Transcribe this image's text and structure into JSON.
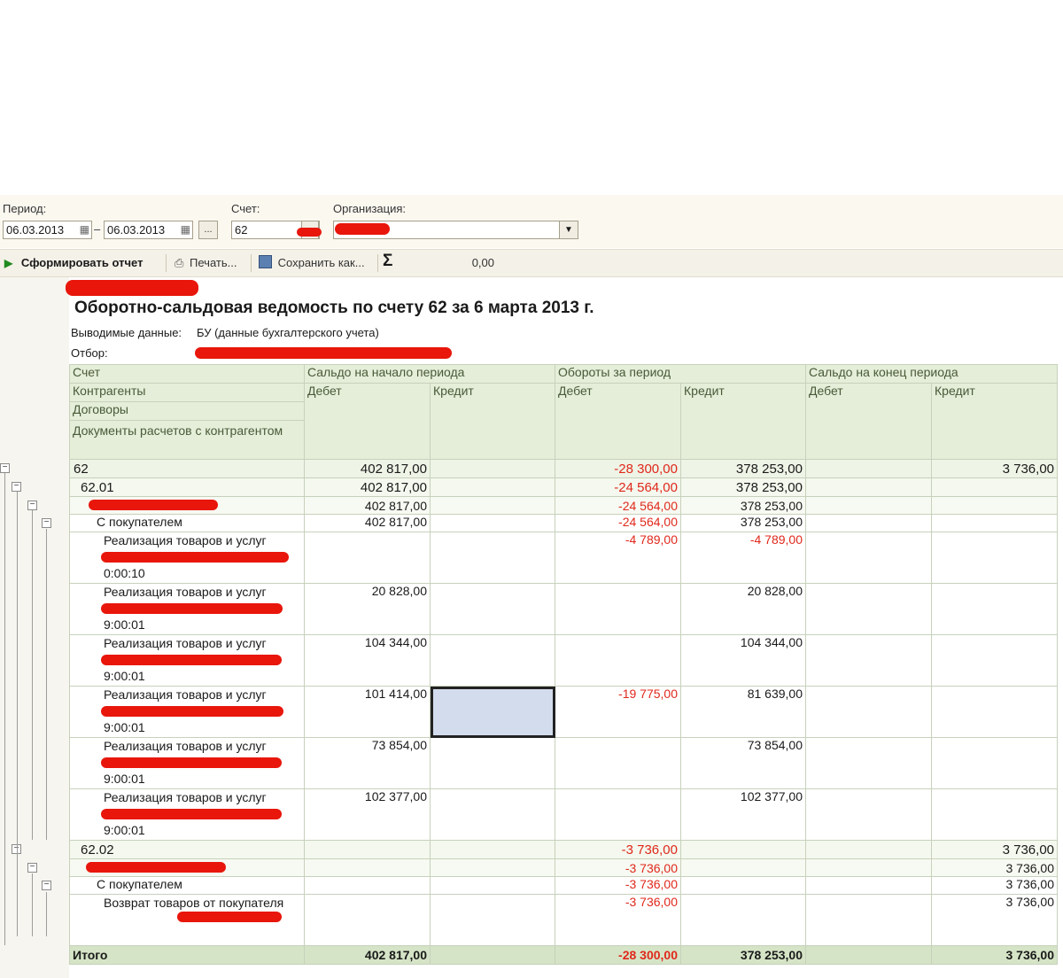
{
  "form": {
    "period_label": "Период:",
    "date_from": "06.03.2013",
    "date_sep": "–",
    "date_to": "06.03.2013",
    "ellipsis": "...",
    "account_label": "Счет:",
    "account_value": "62",
    "org_label": "Организация:"
  },
  "toolbar": {
    "generate": "Сформировать отчет",
    "print": "Печать...",
    "save_as": "Сохранить как...",
    "sum_symbol": "Σ",
    "sum_value": "0,00"
  },
  "report": {
    "title": "Оборотно-сальдовая ведомость по счету 62 за 6 марта 2013 г.",
    "output_label": "Выводимые данные:",
    "output_value": "БУ (данные бухгалтерского учета)",
    "filter_label": "Отбор:",
    "headers": {
      "account": "Счет",
      "counterparties": "Контрагенты",
      "contracts": "Договоры",
      "documents": "Документы расчетов с контрагентом",
      "opening": "Сальдо на начало периода",
      "turnover": "Обороты за период",
      "closing": "Сальдо на конец периода",
      "debit": "Дебет",
      "credit": "Кредит"
    },
    "rows": [
      {
        "level": 1,
        "label": "62",
        "ob_dt": "402 817,00",
        "ob_ct": "",
        "tr_dt": "-28 300,00",
        "tr_ct": "378 253,00",
        "cb_dt": "",
        "cb_ct": "3 736,00"
      },
      {
        "level": 2,
        "label": "62.01",
        "ob_dt": "402 817,00",
        "ob_ct": "",
        "tr_dt": "-24 564,00",
        "tr_ct": "378 253,00",
        "cb_dt": "",
        "cb_ct": ""
      },
      {
        "level": 3,
        "label": "",
        "ob_dt": "402 817,00",
        "ob_ct": "",
        "tr_dt": "-24 564,00",
        "tr_ct": "378 253,00",
        "cb_dt": "",
        "cb_ct": ""
      },
      {
        "level": 4,
        "label": "С покупателем",
        "ob_dt": "402 817,00",
        "ob_ct": "",
        "tr_dt": "-24 564,00",
        "tr_ct": "378 253,00",
        "cb_dt": "",
        "cb_ct": ""
      },
      {
        "level": 5,
        "label": "Реализация товаров и услуг",
        "time": "0:00:10",
        "ob_dt": "",
        "ob_ct": "",
        "tr_dt": "-4 789,00",
        "tr_ct": "-4 789,00",
        "cb_dt": "",
        "cb_ct": ""
      },
      {
        "level": 5,
        "label": "Реализация товаров и услуг",
        "time": "9:00:01",
        "ob_dt": "20 828,00",
        "ob_ct": "",
        "tr_dt": "",
        "tr_ct": "20 828,00",
        "cb_dt": "",
        "cb_ct": ""
      },
      {
        "level": 5,
        "label": "Реализация товаров и услуг",
        "time": "9:00:01",
        "ob_dt": "104 344,00",
        "ob_ct": "",
        "tr_dt": "",
        "tr_ct": "104 344,00",
        "cb_dt": "",
        "cb_ct": ""
      },
      {
        "level": 5,
        "label": "Реализация товаров и услуг",
        "time": "9:00:01",
        "ob_dt": "101 414,00",
        "ob_ct": "",
        "tr_dt": "-19 775,00",
        "tr_ct": "81 639,00",
        "cb_dt": "",
        "cb_ct": "",
        "selected": true
      },
      {
        "level": 5,
        "label": "Реализация товаров и услуг",
        "time": "9:00:01",
        "ob_dt": "73 854,00",
        "ob_ct": "",
        "tr_dt": "",
        "tr_ct": "73 854,00",
        "cb_dt": "",
        "cb_ct": ""
      },
      {
        "level": 5,
        "label": "Реализация товаров и услуг",
        "time": "9:00:01",
        "ob_dt": "102 377,00",
        "ob_ct": "",
        "tr_dt": "",
        "tr_ct": "102 377,00",
        "cb_dt": "",
        "cb_ct": ""
      },
      {
        "level": 2,
        "label": "62.02",
        "ob_dt": "",
        "ob_ct": "",
        "tr_dt": "-3 736,00",
        "tr_ct": "",
        "cb_dt": "",
        "cb_ct": "3 736,00"
      },
      {
        "level": 3,
        "label": "",
        "ob_dt": "",
        "ob_ct": "",
        "tr_dt": "-3 736,00",
        "tr_ct": "",
        "cb_dt": "",
        "cb_ct": "3 736,00"
      },
      {
        "level": 4,
        "label": "С покупателем",
        "ob_dt": "",
        "ob_ct": "",
        "tr_dt": "-3 736,00",
        "tr_ct": "",
        "cb_dt": "",
        "cb_ct": "3 736,00"
      },
      {
        "level": 5,
        "label": "Возврат товаров от покупателя",
        "time": "",
        "ob_dt": "",
        "ob_ct": "",
        "tr_dt": "-3 736,00",
        "tr_ct": "",
        "cb_dt": "",
        "cb_ct": "3 736,00"
      }
    ],
    "total": {
      "label": "Итого",
      "ob_dt": "402 817,00",
      "ob_ct": "",
      "tr_dt": "-28 300,00",
      "tr_ct": "378 253,00",
      "cb_dt": "",
      "cb_ct": "3 736,00"
    }
  }
}
